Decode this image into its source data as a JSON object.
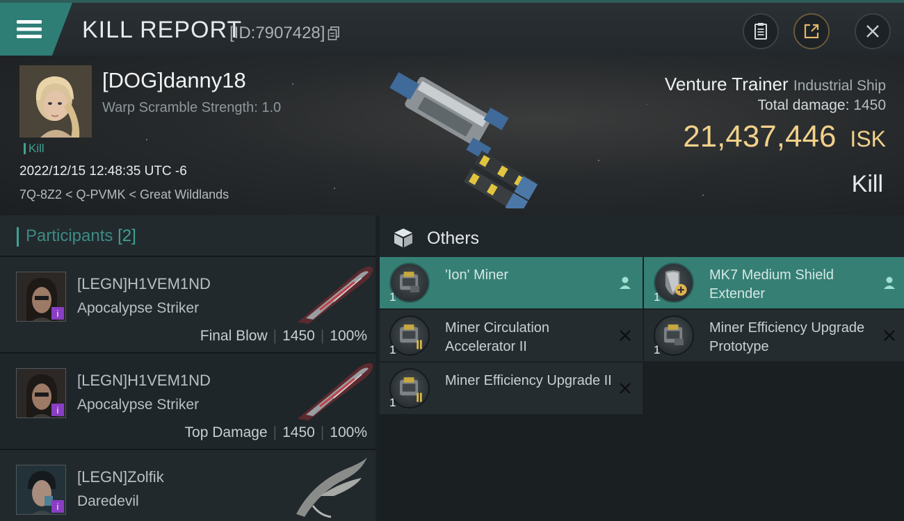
{
  "topbar": {
    "title": "KILL REPORT",
    "report_id": "[ID:7907428]",
    "icons": [
      "menu-icon",
      "copy-icon",
      "clipboard-icon",
      "share-icon",
      "close-icon"
    ]
  },
  "victim": {
    "name": "[DOG]danny18",
    "warp_scramble": "Warp Scramble Strength: 1.0",
    "tag": "Kill",
    "datetime": "2022/12/15 12:48:35 UTC -6",
    "location": "7Q-8Z2 < Q-PVMK < Great Wildlands",
    "ship_name": "Venture Trainer",
    "ship_class": "Industrial Ship",
    "total_damage_label": "Total damage:",
    "total_damage": "1450",
    "isk_value": "21,437,446",
    "isk_unit": "ISK",
    "result": "Kill"
  },
  "participants": {
    "title": "Participants",
    "count": "[2]",
    "rows": [
      {
        "name": "[LEGN]H1VEM1ND",
        "ship": "Apocalypse Striker",
        "role": "Final Blow",
        "damage": "1450",
        "percent": "100%"
      },
      {
        "name": "[LEGN]H1VEM1ND",
        "ship": "Apocalypse Striker",
        "role": "Top Damage",
        "damage": "1450",
        "percent": "100%"
      },
      {
        "name": "[LEGN]Zolfik",
        "ship": "Daredevil",
        "role": "",
        "damage": "",
        "percent": ""
      }
    ]
  },
  "others": {
    "title": "Others",
    "items": [
      {
        "name": "'Ion' Miner",
        "qty": "1",
        "state": "dropped"
      },
      {
        "name": "MK7 Medium Shield Extender",
        "qty": "1",
        "state": "dropped"
      },
      {
        "name": "Miner Circulation Accelerator II",
        "qty": "1",
        "state": "destroyed"
      },
      {
        "name": "Miner Efficiency Upgrade Prototype",
        "qty": "1",
        "state": "destroyed"
      },
      {
        "name": "Miner Efficiency Upgrade II",
        "qty": "1",
        "state": "destroyed"
      }
    ]
  },
  "colors": {
    "accent": "#2e7e76",
    "isk": "#f1d18a",
    "badge": "#8a3ec4"
  }
}
